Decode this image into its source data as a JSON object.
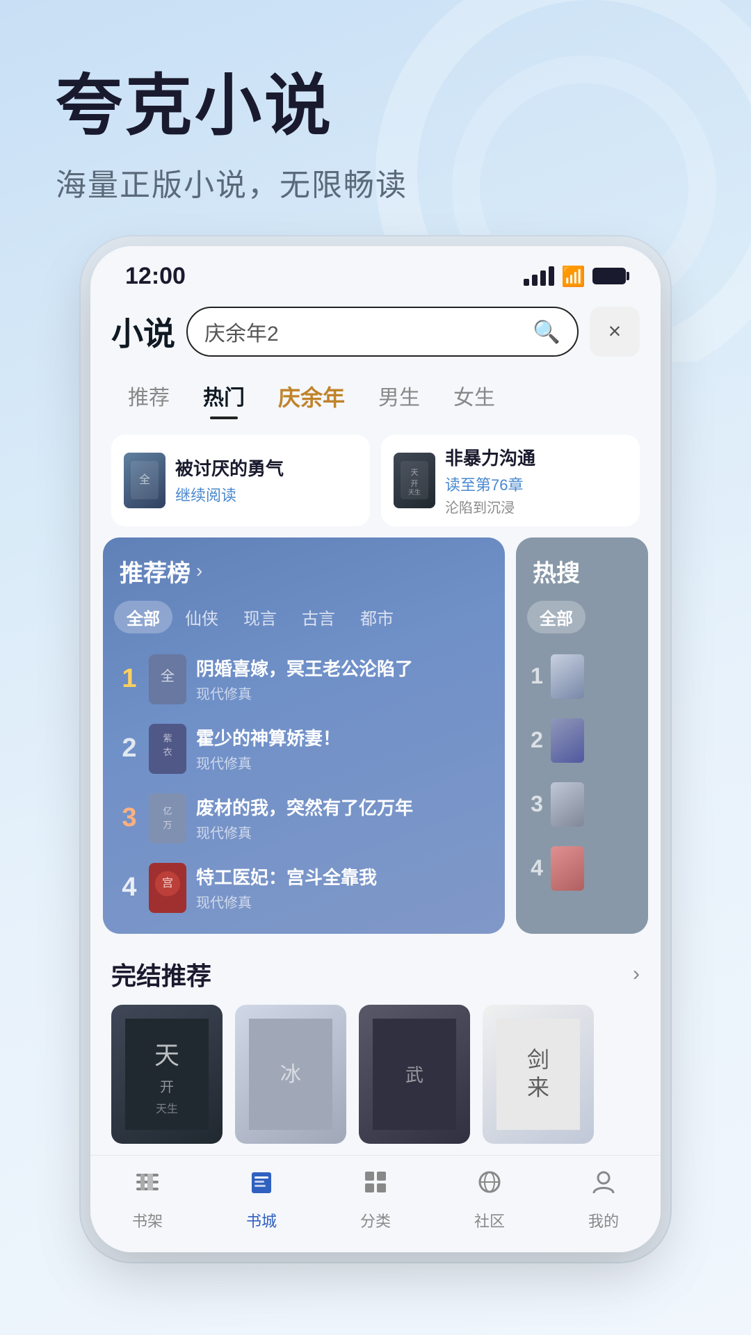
{
  "app": {
    "title": "夸克小说",
    "subtitle": "海量正版小说，无限畅读"
  },
  "status_bar": {
    "time": "12:00",
    "signal": "signal",
    "wifi": "wifi",
    "battery": "battery"
  },
  "header": {
    "app_name": "小说",
    "search_placeholder": "庆余年2",
    "search_value": "庆余年2",
    "close_label": "×"
  },
  "tabs": [
    {
      "id": "recommend",
      "label": "推荐",
      "active": false
    },
    {
      "id": "hot",
      "label": "热门",
      "active": true
    },
    {
      "id": "special",
      "label": "庆余年",
      "active": false,
      "special": true
    },
    {
      "id": "male",
      "label": "男生",
      "active": false
    },
    {
      "id": "female",
      "label": "女生",
      "active": false
    }
  ],
  "recent_reads": [
    {
      "title": "被讨厌的勇气",
      "action": "继续阅读",
      "sub": ""
    },
    {
      "title": "非暴力沟通",
      "action": "读至第76章",
      "sub": "沦陷到沉浸"
    }
  ],
  "ranking": {
    "title": "推荐榜",
    "arrow": "›",
    "filters": [
      "全部",
      "仙侠",
      "现言",
      "古言",
      "都市"
    ],
    "active_filter": "全部",
    "books": [
      {
        "rank": 1,
        "title": "阴婚喜嫁，冥王老公沦陷了",
        "genre": "现代修真"
      },
      {
        "rank": 2,
        "title": "霍少的神算娇妻！",
        "genre": "现代修真"
      },
      {
        "rank": 3,
        "title": "废材的我，突然有了亿万年",
        "genre": "现代修真"
      },
      {
        "rank": 4,
        "title": "特工医妃：宫斗全靠我",
        "genre": "现代修真"
      }
    ]
  },
  "hot_search": {
    "title": "热搜",
    "filters": [
      "全部"
    ],
    "active_filter": "全部",
    "books": [
      {
        "rank": 1
      },
      {
        "rank": 2
      },
      {
        "rank": 3
      },
      {
        "rank": 4
      }
    ]
  },
  "completed": {
    "title": "完结推荐",
    "arrow": "›",
    "books": [
      {
        "id": 1,
        "label": "天"
      },
      {
        "id": 2,
        "label": ""
      },
      {
        "id": 3,
        "label": ""
      },
      {
        "id": 4,
        "label": "剑来"
      }
    ]
  },
  "bottom_nav": [
    {
      "id": "shelf",
      "label": "书架",
      "icon": "📚",
      "active": false
    },
    {
      "id": "bookstore",
      "label": "书城",
      "icon": "📖",
      "active": true
    },
    {
      "id": "category",
      "label": "分类",
      "icon": "⊞",
      "active": false
    },
    {
      "id": "community",
      "label": "社区",
      "icon": "🌐",
      "active": false
    },
    {
      "id": "mine",
      "label": "我的",
      "icon": "👤",
      "active": false
    }
  ]
}
